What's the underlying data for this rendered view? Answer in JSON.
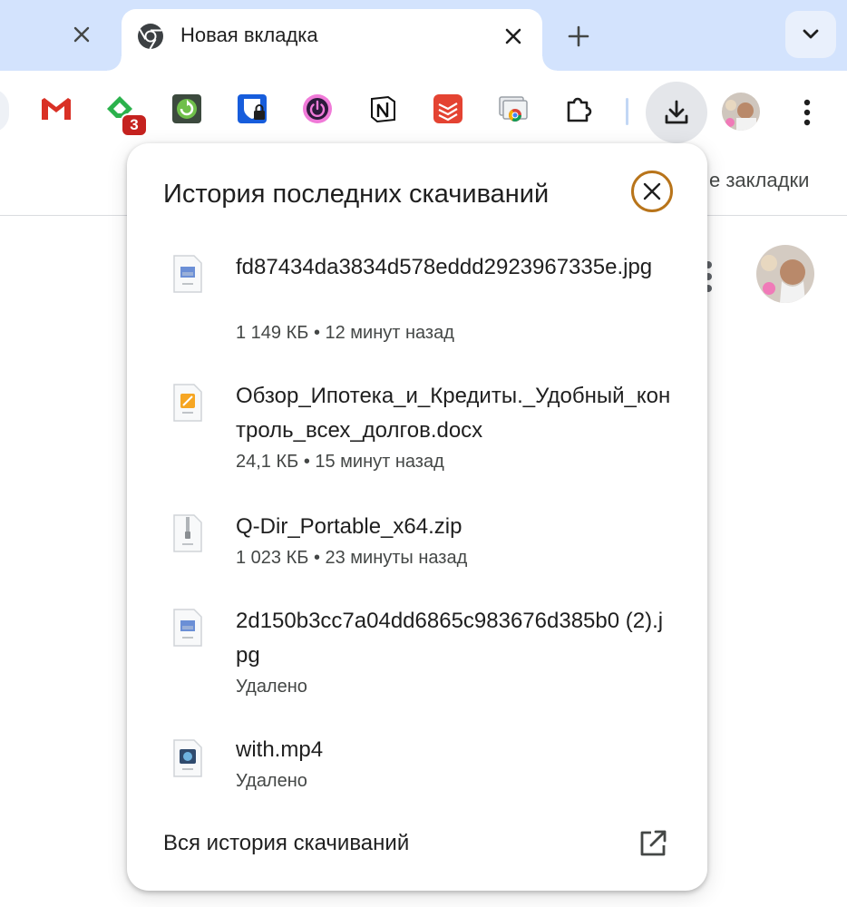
{
  "tabs": {
    "active_title": "Новая вкладка",
    "inactive_close_icon": "close-icon",
    "new_tab_icon": "plus-icon",
    "tab_search_icon": "chevron-down-icon"
  },
  "toolbar": {
    "extensions": [
      {
        "name": "gmail-icon"
      },
      {
        "name": "feedly-icon",
        "badge": "3"
      },
      {
        "name": "refresh-extension-icon"
      },
      {
        "name": "bitwarden-icon"
      },
      {
        "name": "power-icon"
      },
      {
        "name": "notion-icon"
      },
      {
        "name": "todoist-icon"
      },
      {
        "name": "chrome-remote-desktop-icon"
      },
      {
        "name": "puzzle-icon"
      }
    ],
    "download_icon": "download-icon",
    "menu_icon": "more-vert-icon"
  },
  "bookmarks": {
    "label_partial": "е закладки"
  },
  "downloads": {
    "title": "История последних скачиваний",
    "items": [
      {
        "name": "fd87434da3834d578eddd2923967335e.jpg",
        "status": "1 149 КБ • 12 минут назад",
        "icon": "image-file-icon"
      },
      {
        "name": "Обзор_Ипотека_и_Кредиты._Удобный_контроль_всех_долгов.docx",
        "status": "24,1 КБ • 15 минут назад",
        "icon": "doc-file-icon"
      },
      {
        "name": "Q-Dir_Portable_x64.zip",
        "status": "1 023 КБ • 23 минуты назад",
        "icon": "zip-file-icon"
      },
      {
        "name": "2d150b3cc7a04dd6865c983676d385b0 (2).jpg",
        "status": "Удалено",
        "icon": "image-file-icon"
      },
      {
        "name": "with.mp4",
        "status": "Удалено",
        "icon": "video-file-icon"
      }
    ],
    "footer_link": "Вся история скачиваний"
  },
  "colors": {
    "tabstrip": "#d3e3fd",
    "badge": "#c5221f",
    "close_focus_ring": "#b8741a"
  }
}
